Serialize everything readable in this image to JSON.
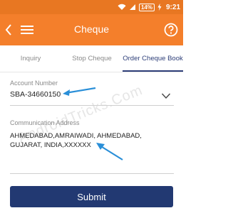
{
  "statusbar": {
    "battery": "14%",
    "time": "9:21",
    "icons": [
      "wifi-icon",
      "signal-icon",
      "battery-charging-icon"
    ]
  },
  "appbar": {
    "title": "Cheque",
    "back_icon": "back-chevron-icon",
    "menu_icon": "hamburger-menu-icon",
    "help_icon": "help-circle-icon"
  },
  "tabs": [
    {
      "label": "Inquiry"
    },
    {
      "label": "Stop Cheque"
    },
    {
      "label": "Order Cheque Book",
      "active": true
    }
  ],
  "form": {
    "account_label": "Account Number",
    "account_value": "SBA-34660150",
    "address_label": "Communication Address",
    "address_value": "AHMEDABAD,AMRAIWADI, AHMEDABAD, GUJARAT, INDIA,XXXXXX",
    "submit_label": "Submit"
  },
  "watermark": "AndroidTricks.Com",
  "colors": {
    "statusbar": "#e87722",
    "appbar": "#f47f2b",
    "accent_blue": "#2d3e78",
    "submit": "#223972",
    "annotation_arrow": "#2a8fd8"
  }
}
